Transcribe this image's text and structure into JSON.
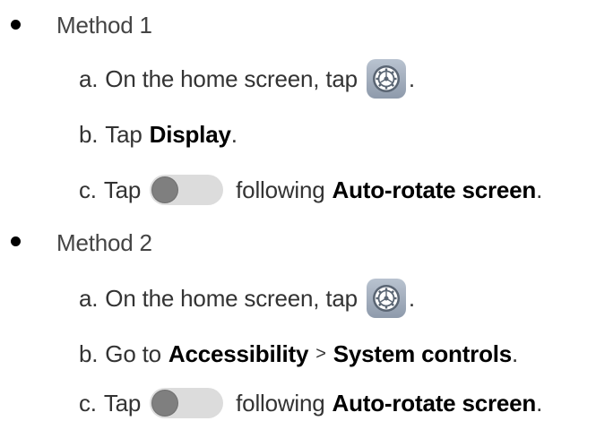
{
  "methods": [
    {
      "label": "Method 1",
      "steps": [
        {
          "letter": "a.",
          "text_before": "On the home screen, tap",
          "icon": "settings-gear-icon",
          "text_after": "."
        },
        {
          "letter": "b.",
          "text_before": "Tap",
          "bold": "Display",
          "text_after": "."
        },
        {
          "letter": "c.",
          "text_before": "Tap",
          "icon": "toggle-switch-icon",
          "text_middle": "following",
          "bold": "Auto-rotate screen",
          "text_after": "."
        }
      ]
    },
    {
      "label": "Method 2",
      "steps": [
        {
          "letter": "a.",
          "text_before": "On the home screen, tap",
          "icon": "settings-gear-icon",
          "text_after": "."
        },
        {
          "letter": "b.",
          "text_before": "Go to",
          "bold": "Accessibility",
          "separator": ">",
          "bold2": "System controls",
          "text_after": "."
        },
        {
          "letter": "c.",
          "text_before": "Tap",
          "icon": "toggle-switch-icon",
          "text_middle": "following",
          "bold": "Auto-rotate screen",
          "text_after": "."
        }
      ]
    }
  ],
  "colors": {
    "text": "#333333",
    "bold_text": "#000000",
    "bullet": "#000000",
    "toggle_track": "#dcdcdc",
    "toggle_knob": "#7f7f7f",
    "settings_bg": "#9aa6b6"
  }
}
